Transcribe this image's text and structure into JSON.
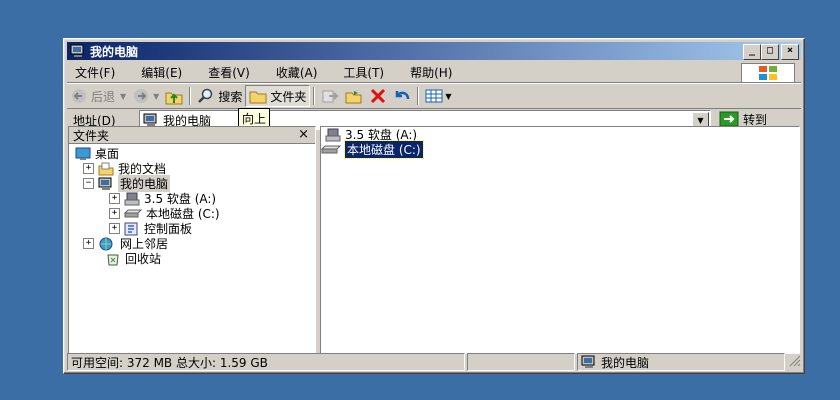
{
  "window": {
    "title": "我的电脑"
  },
  "titlebar_buttons": {
    "minimize": "_",
    "maximize": "□",
    "close": "×"
  },
  "menu": [
    "文件(F)",
    "编辑(E)",
    "查看(V)",
    "收藏(A)",
    "工具(T)",
    "帮助(H)"
  ],
  "toolbar": {
    "back": "后退",
    "search": "搜索",
    "folders": "文件夹"
  },
  "address": {
    "label": "地址(D)",
    "value": "我的电脑",
    "go": "转到"
  },
  "tooltip": "向上",
  "folders_pane": {
    "title": "文件夹",
    "close": "×"
  },
  "tree": [
    {
      "label": "桌面"
    },
    {
      "label": "我的文档",
      "expander": "+"
    },
    {
      "label": "我的电脑",
      "expander": "−"
    },
    {
      "label": "3.5 软盘 (A:)",
      "expander": "+"
    },
    {
      "label": "本地磁盘 (C:)",
      "expander": "+"
    },
    {
      "label": "控制面板",
      "expander": "+"
    },
    {
      "label": "网上邻居",
      "expander": "+"
    },
    {
      "label": "回收站"
    }
  ],
  "files": [
    {
      "label": "3.5 软盘 (A:)"
    },
    {
      "label": "本地磁盘 (C:)"
    }
  ],
  "status": {
    "left": "可用空间: 372 MB 总大小: 1.59 GB",
    "right": "我的电脑"
  },
  "colors": {
    "desktop": "#3a6ea5",
    "title_start": "#0a246a",
    "title_end": "#a6caf0",
    "face": "#d4d0c8"
  }
}
